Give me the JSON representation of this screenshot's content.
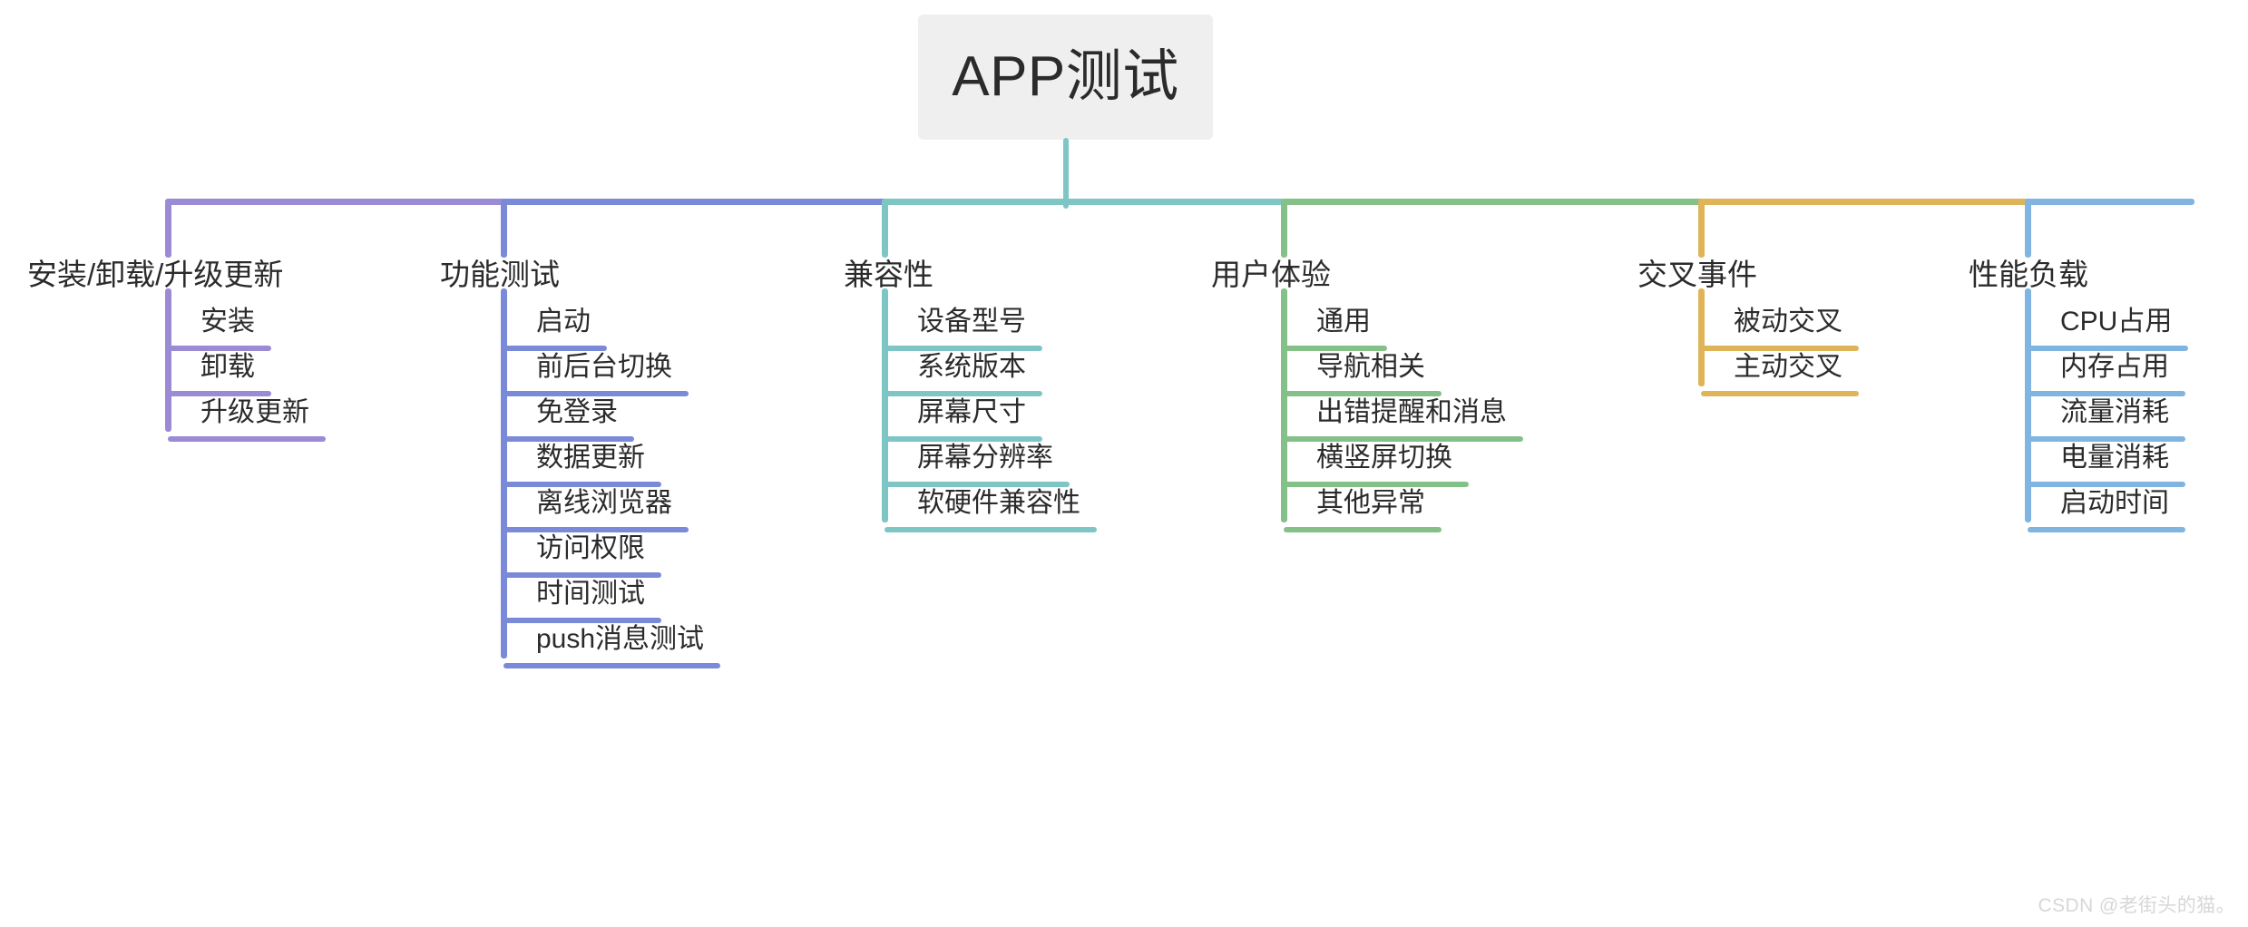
{
  "diagram": {
    "title": "APP测试",
    "watermark": "CSDN @老街头的猫。",
    "root": {
      "label": "APP测试",
      "stem_color": "#7ec6c6",
      "box_color": "#efefef"
    },
    "branches": [
      {
        "label": "安装/卸载/升级更新",
        "color": "#9b8ad4",
        "leaves": [
          {
            "label": "安装"
          },
          {
            "label": "卸载"
          },
          {
            "label": "升级更新"
          }
        ]
      },
      {
        "label": "功能测试",
        "color": "#7b8ad8",
        "leaves": [
          {
            "label": "启动"
          },
          {
            "label": "前后台切换"
          },
          {
            "label": "免登录"
          },
          {
            "label": "数据更新"
          },
          {
            "label": "离线浏览器"
          },
          {
            "label": "访问权限"
          },
          {
            "label": "时间测试"
          },
          {
            "label": "push消息测试"
          }
        ]
      },
      {
        "label": "兼容性",
        "color": "#7ec6c6",
        "leaves": [
          {
            "label": "设备型号"
          },
          {
            "label": "系统版本"
          },
          {
            "label": "屏幕尺寸"
          },
          {
            "label": "屏幕分辨率"
          },
          {
            "label": "软硬件兼容性"
          }
        ]
      },
      {
        "label": "用户体验",
        "color": "#84c188",
        "leaves": [
          {
            "label": "通用"
          },
          {
            "label": "导航相关"
          },
          {
            "label": "出错提醒和消息"
          },
          {
            "label": "横竖屏切换"
          },
          {
            "label": "其他异常"
          }
        ]
      },
      {
        "label": "交叉事件",
        "color": "#dfb459",
        "leaves": [
          {
            "label": "被动交叉"
          },
          {
            "label": "主动交叉"
          }
        ]
      },
      {
        "label": "性能负载",
        "color": "#7fb5e0",
        "leaves": [
          {
            "label": "CPU占用"
          },
          {
            "label": "内存占用"
          },
          {
            "label": "流量消耗"
          },
          {
            "label": "电量消耗"
          },
          {
            "label": "启动时间"
          }
        ]
      }
    ]
  }
}
